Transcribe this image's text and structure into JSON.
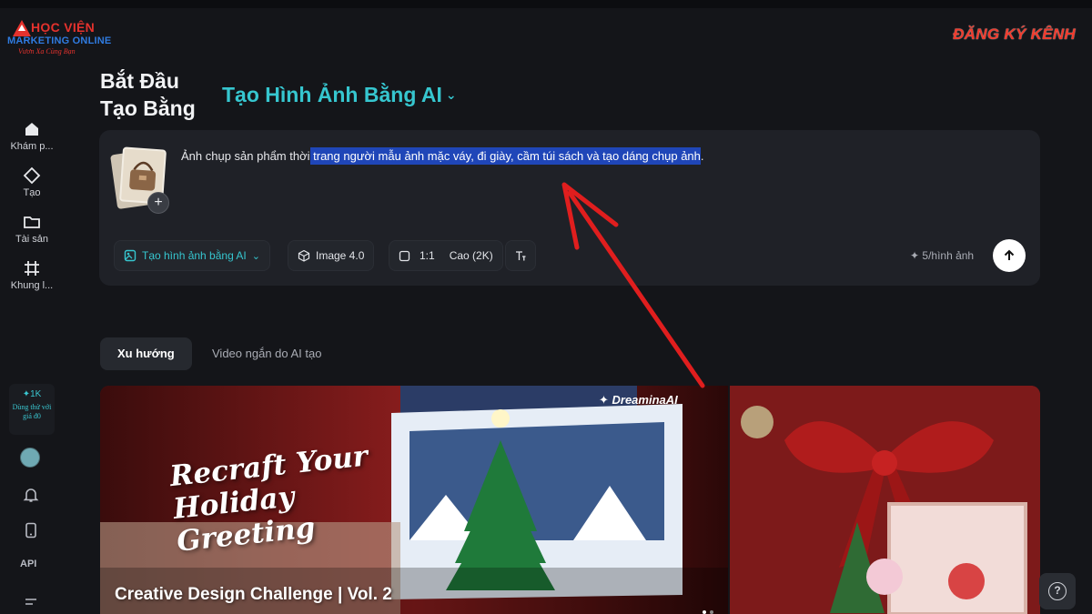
{
  "logo": {
    "line1": "HỌC VIỆN",
    "line2": "MARKETING ONLINE",
    "tagline": "Vươn Xa Cùng Bạn"
  },
  "subscribe_label": "ĐĂNG KÝ KÊNH",
  "sidebar": {
    "items": [
      {
        "label": "Khám p...",
        "icon": "home-icon"
      },
      {
        "label": "Tạo",
        "icon": "diamond-icon"
      },
      {
        "label": "Tài sản",
        "icon": "folder-icon"
      },
      {
        "label": "Khung l...",
        "icon": "frame-icon"
      }
    ],
    "credits": {
      "amount": "✦1K",
      "promo": "Dùng thử với giá đ0"
    },
    "api_label": "API"
  },
  "header": {
    "title": "Bắt Đầu\nTạo Bằng",
    "mode": "Tạo Hình Ảnh Bằng AI"
  },
  "prompt": {
    "text_plain": "Ảnh chụp sản phẩm thời",
    "text_highlighted": " trang người mẫu ảnh mặc váy, đi giày, cầm túi sách và tạo dáng chụp ảnh",
    "text_end": ".",
    "add_symbol": "+"
  },
  "toolbar": {
    "mode_label": "Tạo hình ảnh bằng AI",
    "model_label": "Image 4.0",
    "ratio_label": "1:1",
    "quality_label": "Cao (2K)",
    "cost_label": "✦ 5/hình ảnh"
  },
  "tabs": [
    {
      "label": "Xu hướng",
      "active": true
    },
    {
      "label": "Video ngắn do AI tạo",
      "active": false
    }
  ],
  "banner": {
    "brand": "✦ DreaminaAI",
    "headline": "Recraft Your Holiday Greeting",
    "caption": "Creative Design Challenge | Vol. 2"
  },
  "help_label": "?",
  "colors": {
    "accent": "#36c6cf",
    "highlight": "#1f46b8",
    "arrow": "#e01e1e",
    "brand_red": "#e5322d"
  }
}
